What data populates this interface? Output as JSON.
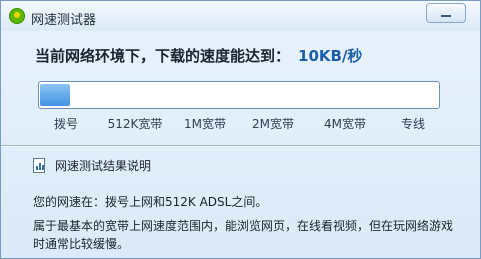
{
  "window": {
    "title": "网速测试器",
    "icons": {
      "app": "speed-test-app-icon",
      "minimize": "minimize-icon",
      "report": "report-chart-icon"
    },
    "colors": {
      "accent": "#1a5fa8",
      "bar_fill": "#4a9ae8"
    }
  },
  "header": {
    "prefix": "当前网络环境下，下载的速度能达到：",
    "speed": "10KB/秒"
  },
  "meter": {
    "level_fraction": 0.075,
    "ticks": [
      "拨号",
      "512K宽带",
      "1M宽带",
      "2M宽带",
      "4M宽带",
      "专线"
    ]
  },
  "result": {
    "title": "网速测试结果说明",
    "line1": "您的网速在：拨号上网和512K ADSL之间。",
    "line2": "属于最基本的宽带上网速度范围内，能浏览网页，在线看视频，但在玩网络游戏",
    "line3": "时通常比较缓慢。"
  }
}
